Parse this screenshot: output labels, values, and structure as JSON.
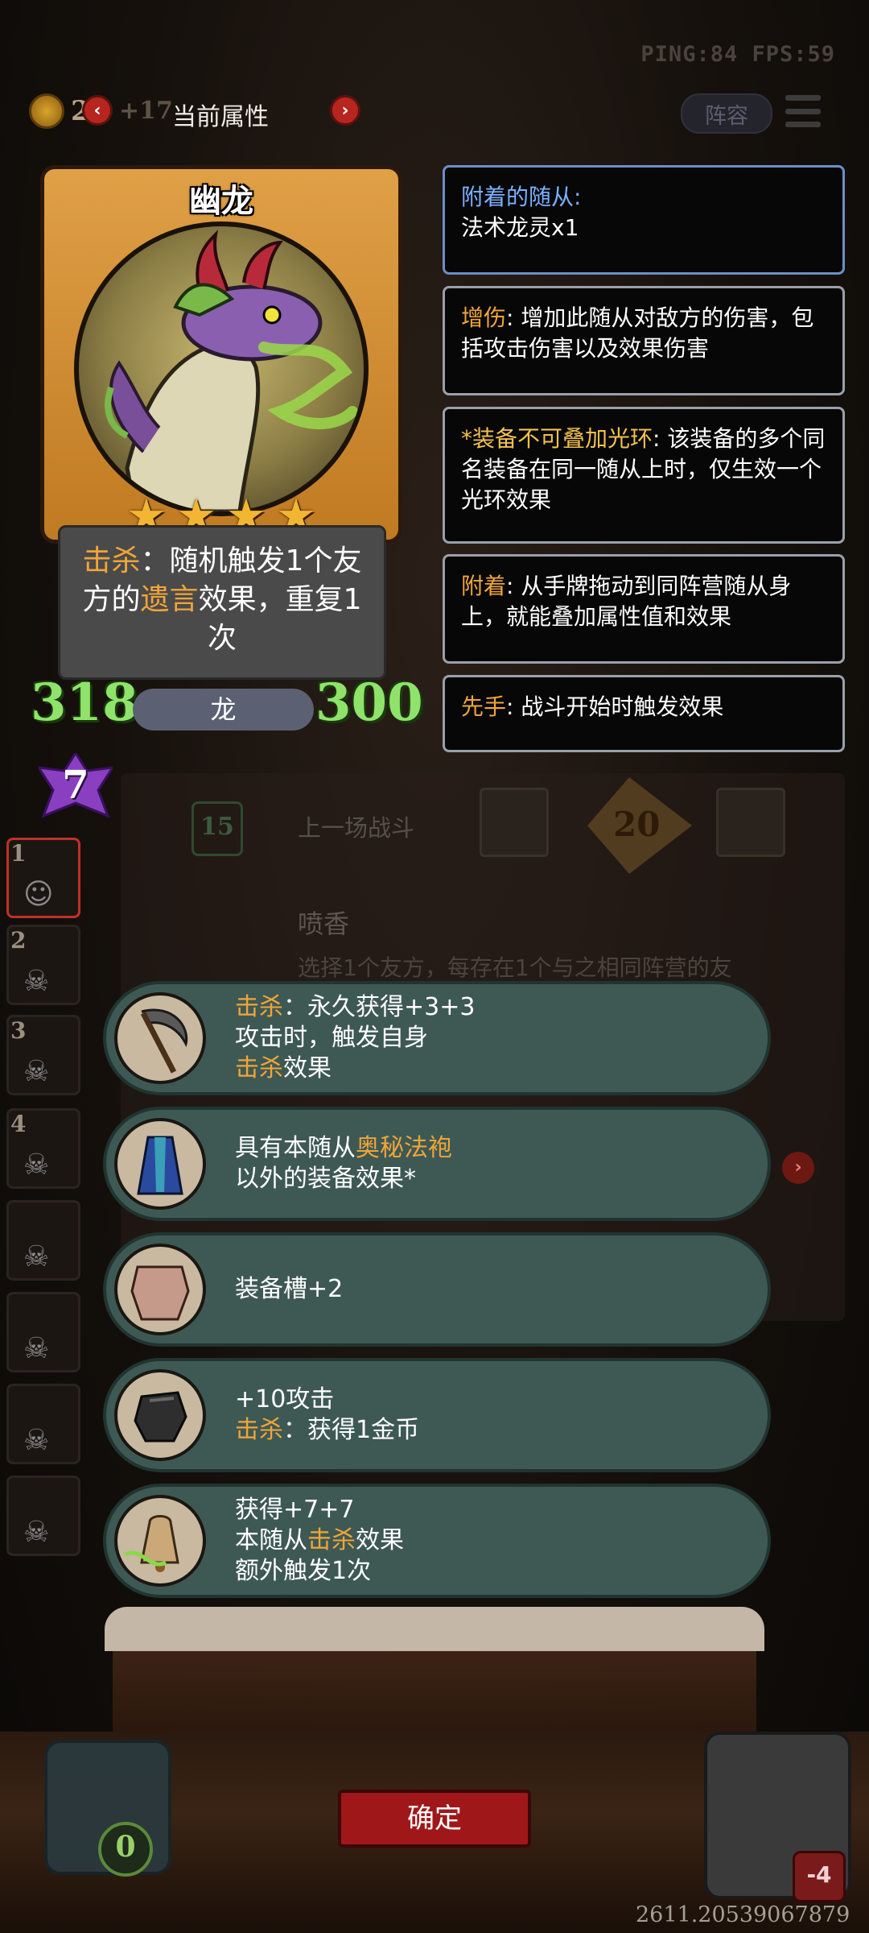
{
  "status": {
    "ping_fps": "PING:84  FPS:59"
  },
  "topbar": {
    "coin_count": "2",
    "coin_inc": "+17",
    "title": "当前属性",
    "lineup": "阵容"
  },
  "card": {
    "name": "幽龙",
    "stars": [
      "★",
      "★",
      "★",
      "★"
    ],
    "desc": {
      "kill": "击杀",
      "p1": "：随机触发1个友方的",
      "deathrattle": "遗言",
      "p2": "效果，重复1次"
    },
    "attack": "318",
    "health": "300",
    "tribe": "龙",
    "tier": "7"
  },
  "info": {
    "attached": {
      "label": "附着的随从:",
      "value": "法术龙灵x1"
    },
    "buff": {
      "key": "增伤",
      "text": ": 增加此随从对敌方的伤害，包括攻击伤害以及效果伤害"
    },
    "nostack": {
      "key": "*装备不可叠加光环",
      "text": ": 该装备的多个同名装备在同一随从上时，仅生效一个光环效果"
    },
    "attach": {
      "key": "附着",
      "text": ": 从手牌拖动到同阵营随从身上，就能叠加属性值和效果"
    },
    "first": {
      "key": "先手",
      "text": ": 战斗开始时触发效果"
    }
  },
  "battle": {
    "level": "15",
    "last_fight": "上一场战斗",
    "damage": "20",
    "spray_title": "喷香",
    "spray_desc": "选择1个友方，每存在1个与之相同阵营的友"
  },
  "roster": [
    "1",
    "2",
    "3",
    "4",
    "",
    "",
    "",
    ""
  ],
  "equipment": [
    {
      "icon": "scythe-icon",
      "lines": [
        {
          "y": "击杀",
          "t": "：永久获得+3+3"
        },
        {
          "y": "",
          "t": "攻击时，触发自身"
        },
        {
          "y": "击杀",
          "t": "效果"
        }
      ]
    },
    {
      "icon": "robe-icon",
      "lines": [
        {
          "y": "",
          "t": "具有本随从",
          "y2": "奥秘法袍"
        },
        {
          "y": "",
          "t": "以外的装备效果*"
        }
      ]
    },
    {
      "icon": "armor-icon",
      "lines": [
        {
          "y": "",
          "t": "装备槽+2"
        }
      ]
    },
    {
      "icon": "gauntlet-icon",
      "lines": [
        {
          "y": "",
          "t": "+10攻击"
        },
        {
          "y": "击杀",
          "t": "：获得1金币"
        }
      ]
    },
    {
      "icon": "bell-icon",
      "lines": [
        {
          "y": "",
          "t": "获得+7+7"
        },
        {
          "y": "",
          "t": "本随从",
          "y2": "击杀",
          "t2": "效果"
        },
        {
          "y": "",
          "t": "额外触发1次"
        }
      ]
    }
  ],
  "confirm": "确定",
  "hero": {
    "left_value": "0",
    "right_hp": "-4"
  },
  "footer_value": "2611.20539067879"
}
